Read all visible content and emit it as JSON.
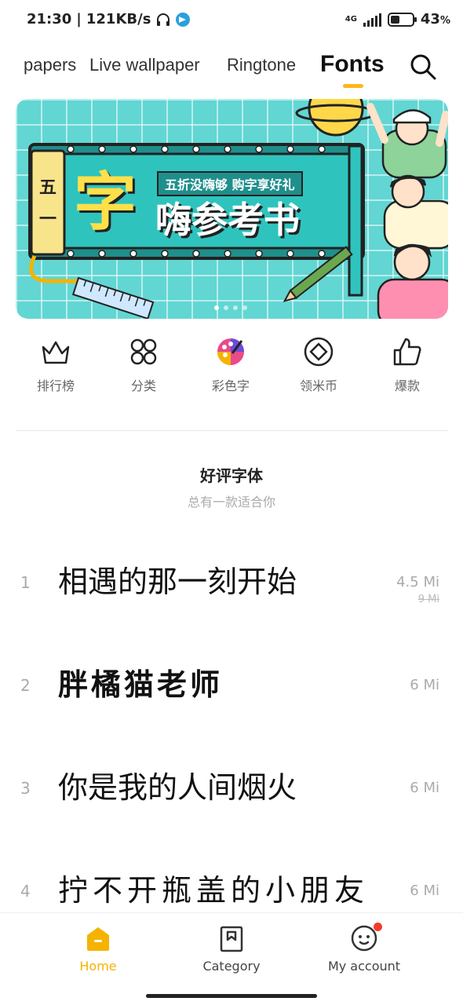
{
  "status_bar": {
    "time": "21:30",
    "speed": "121KB/s",
    "network": "4G",
    "battery_percent": "43",
    "battery_suffix": "%",
    "battery_level": 0.43
  },
  "tabs": [
    {
      "label": "papers",
      "active": false
    },
    {
      "label": "Live wallpaper",
      "active": false
    },
    {
      "label": "Ringtone",
      "active": false
    },
    {
      "label": "Fonts",
      "active": true
    }
  ],
  "banner": {
    "badge": "五一",
    "big_char": "字",
    "subtitle": "五折没嗨够 购字享好礼",
    "title": "嗨参考书",
    "page_count": 4,
    "active_page": 0
  },
  "quick_links": [
    {
      "label": "排行榜",
      "icon": "crown-icon"
    },
    {
      "label": "分类",
      "icon": "grid-icon"
    },
    {
      "label": "彩色字",
      "icon": "palette-icon"
    },
    {
      "label": "领米币",
      "icon": "coin-icon"
    },
    {
      "label": "爆款",
      "icon": "thumbs-up-icon"
    }
  ],
  "section": {
    "title": "好评字体",
    "subtitle": "总有一款适合你"
  },
  "fonts": [
    {
      "rank": "1",
      "sample": "相遇的那一刻开始",
      "price": "4.5 Mi",
      "old_price": "9 Mi"
    },
    {
      "rank": "2",
      "sample": "胖橘猫老师",
      "price": "6 Mi",
      "old_price": ""
    },
    {
      "rank": "3",
      "sample": "你是我的人间烟火",
      "price": "6 Mi",
      "old_price": ""
    },
    {
      "rank": "4",
      "sample": "拧不开瓶盖的小朋友",
      "price": "6 Mi",
      "old_price": ""
    }
  ],
  "bottom_nav": [
    {
      "label": "Home",
      "icon": "home-icon",
      "active": true
    },
    {
      "label": "Category",
      "icon": "bookmark-icon",
      "active": false
    },
    {
      "label": "My account",
      "icon": "face-icon",
      "active": false
    }
  ],
  "colors": {
    "accent": "#f5b300",
    "banner_bg": "#62d6d3",
    "badge_red": "#f23b2c"
  }
}
